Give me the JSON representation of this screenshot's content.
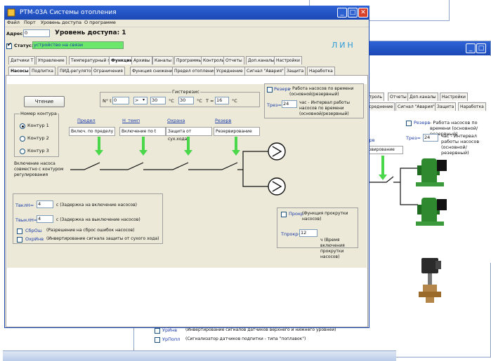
{
  "window": {
    "title": "PTM-03A Системы отопления",
    "menu": [
      "Файл",
      "Порт",
      "Уровень доступа",
      "О программе"
    ]
  },
  "header": {
    "address_label": "Адрес",
    "address_value": "0",
    "access_level": "Уровень доступа: 1",
    "status_label": "Статус:",
    "status_value": "устройство на связи",
    "logo": "ЛИН"
  },
  "tabs_row1": [
    "Датчики Т",
    "Управление",
    "Температурный график",
    "Функции",
    "Архивы",
    "Каналы",
    "Программы",
    "Контроль",
    "Отчеты",
    "Доп.каналы",
    "Настройки"
  ],
  "tabs_row1_active": "Функции",
  "tabs_row2": [
    "Насосы",
    "Подпитка",
    "ПИД-регулятор",
    "Ограничения",
    "Функция снижения Т",
    "Предел отопления",
    "Усреднение",
    "Сигнал \"Авария\"",
    "Защита",
    "Наработка"
  ],
  "tabs_row2_active": "Насосы",
  "pumps": {
    "read_button": "Чтение",
    "contour_group_title": "Номер контура",
    "contours": [
      "Контур 1",
      "Контур 2",
      "Контур 3"
    ],
    "contour_selected": 0,
    "hysteresis_label": "Гистерезис",
    "nt_label": "N° t",
    "nt_value": "0",
    "op_value": ">",
    "t1_value": "30",
    "t2_value": "30",
    "t_label": "Т =",
    "t_value": "16",
    "unit_c": "°С",
    "columns": [
      {
        "title": "Предел",
        "state": "Включ. по пределу"
      },
      {
        "title": "Н_темп",
        "state": "Включение по t"
      },
      {
        "title": "Охрана",
        "state": "Защита от сух.хода"
      },
      {
        "title": "Резерв",
        "state": "Резервирование"
      }
    ],
    "note_box": "Включение насоса совместно с контуром регулирования",
    "reserve_check_label": "Резерв",
    "reserve_check_desc": "- Работа насосов по времени (основной/резервный)",
    "treserve_label": "Трез=",
    "treserve_value": "24",
    "treserve_desc": "час - Интервал работы насосов по времени (основной/резервный)",
    "tvkl_label": "ТвклН=",
    "tvkl_value": "4",
    "tvkl_desc": "с (Задержка на включение насосов)",
    "tvykl_label": "ТвыклН=",
    "tvykl_value": "4",
    "tvykl_desc": "с (Задержка на выключение насосов)",
    "reset_label": "СбрОш",
    "reset_desc": "(Разрешение на сброс ошибок насосов)",
    "inv_label": "ОхрИнв",
    "inv_desc": "(Инвертирование сигнала защиты от сухого хода)",
    "prokr_label": "Прокр",
    "prokr_desc": "(Функция прокрутки насосов)",
    "tprokr_label": "Тпрокр=",
    "tprokr_value": "12",
    "tprokr_desc": "ч (Время включения прокрутки насосов)"
  },
  "back_window": {
    "tabs_a": [
      "...нтроль",
      "Отчеты",
      "Доп.каналы",
      "Настройки"
    ],
    "tabs_b": [
      "...Усреднение",
      "Сигнал \"Авария\"",
      "Защита",
      "Наработка"
    ],
    "reserve_check_label": "Резерв",
    "reserve_desc": "- Работа насосов по времени (основной/резервный)",
    "treserve_label": "Трез=",
    "treserve_value": "24",
    "treserve_desc": "час - Интервал работы насосов (основной/резервный)",
    "partial_label": "...зерв",
    "partial_state": "...ервирование",
    "bottom_rows": [
      {
        "label": "УрИнв",
        "desc": "(Инвертирование сигналов датчиков верхнего и нижнего уровней)"
      },
      {
        "label": "УрПопл",
        "desc": "(Сигнализатор датчиков подпитки - типа \"поплавок\")"
      }
    ]
  },
  "colors": {
    "titlebar": "#1b48b5",
    "panel": "#ece9d8",
    "arrow": "#4ad84a",
    "pump_green": "#2f8a2f"
  }
}
